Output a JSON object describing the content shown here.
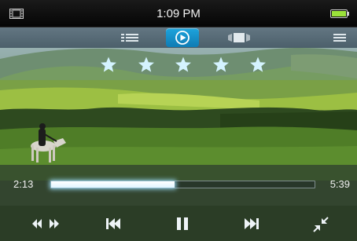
{
  "status_bar": {
    "time": "1:09 PM",
    "left_icon": "film-icon",
    "right_icon": "battery-icon",
    "battery_color": "#9be23a"
  },
  "mode_bar": {
    "buttons": [
      {
        "icon": "list-view-icon",
        "selected": false
      },
      {
        "icon": "now-playing-icon",
        "selected": true
      },
      {
        "icon": "coverflow-icon",
        "selected": false
      }
    ],
    "menu_icon": "menu-icon",
    "accent": "#1a95d1"
  },
  "rating": {
    "max": 5,
    "value": 0,
    "star_color": "#d4f3ff"
  },
  "playback": {
    "elapsed": "2:13",
    "total": "5:39",
    "progress": 0.47
  },
  "transport": {
    "controls": [
      "seek-icon",
      "previous-icon",
      "pause-icon",
      "next-icon",
      "shrink-icon"
    ]
  }
}
